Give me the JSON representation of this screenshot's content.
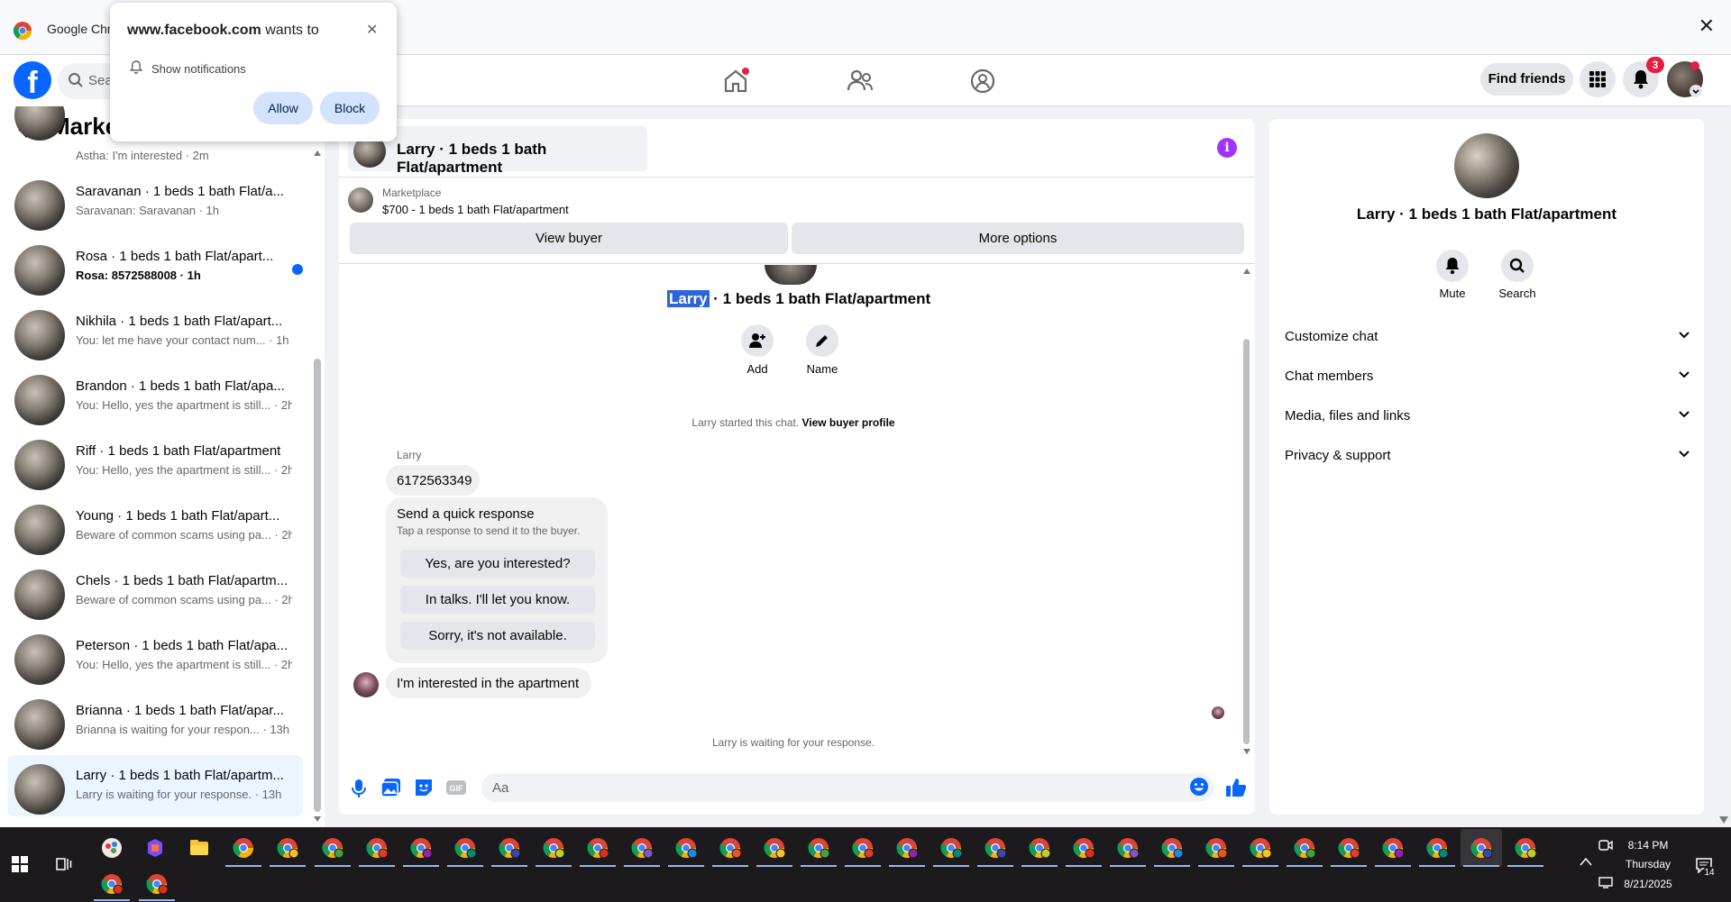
{
  "chrome": {
    "title": "Google Chro",
    "close": "✕"
  },
  "popup": {
    "site": "www.facebook.com",
    "wants": " wants to",
    "perm": "Show notifications",
    "allow": "Allow",
    "block": "Block",
    "close": "✕"
  },
  "fb": {
    "logo": "f",
    "search_placeholder": "Sea",
    "find_friends": "Find friends",
    "notif_count": "3"
  },
  "sidebar": {
    "title": "Marke",
    "conversations": [
      {
        "name": "",
        "preview": "Astha: I'm interested · 2m",
        "unread": false
      },
      {
        "name": "Saravanan · 1 beds 1 bath Flat/a...",
        "preview": "Saravanan: Saravanan · 1h",
        "unread": false
      },
      {
        "name": "Rosa · 1 beds 1 bath Flat/apart...",
        "preview": "Rosa: 8572588008 · 1h",
        "unread": true
      },
      {
        "name": "Nikhila · 1 beds 1 bath Flat/apart...",
        "preview": "You: let me have your contact num... · 1h",
        "unread": false
      },
      {
        "name": "Brandon · 1 beds 1 bath Flat/apa...",
        "preview": "You: Hello, yes the apartment is still... · 2h",
        "unread": false
      },
      {
        "name": "Riff · 1 beds 1 bath Flat/apartment",
        "preview": "You: Hello, yes the apartment is still... · 2h",
        "unread": false
      },
      {
        "name": "Young · 1 beds 1 bath Flat/apart...",
        "preview": "Beware of common scams using pa... · 2h",
        "unread": false
      },
      {
        "name": "Chels · 1 beds 1 bath Flat/apartm...",
        "preview": "Beware of common scams using pa... · 2h",
        "unread": false
      },
      {
        "name": "Peterson · 1 beds 1 bath Flat/apa...",
        "preview": "You: Hello, yes the apartment is still... · 2h",
        "unread": false
      },
      {
        "name": "Brianna · 1 beds 1 bath Flat/apar...",
        "preview": "Brianna is waiting for your respon... · 13h",
        "unread": false
      },
      {
        "name": "Larry · 1 beds 1 bath Flat/apartm...",
        "preview": "Larry is waiting for your response. · 13h",
        "unread": false
      }
    ]
  },
  "chat": {
    "header_title": "Larry · 1 beds 1 bath Flat/apartment",
    "info": "i",
    "marketplace_label": "Marketplace",
    "listing": "$700 - 1 beds 1 bath Flat/apartment",
    "view_buyer": "View buyer",
    "more_options": "More options",
    "name_selected": "Larry",
    "name_rest": " · 1 beds 1 bath Flat/apartment",
    "add_label": "Add",
    "name_label": "Name",
    "started_text": "Larry started this chat. ",
    "view_buyer_profile": "View buyer profile",
    "sender": "Larry",
    "phone_msg": "6172563349",
    "quick_title": "Send a quick response",
    "quick_sub": "Tap a response to send it to the buyer.",
    "quick_replies": [
      "Yes, are you interested?",
      "In talks. I'll let you know.",
      "Sorry, it's not available."
    ],
    "interested_msg": "I'm interested in the apartment",
    "waiting": "Larry is waiting for your response.",
    "composer_placeholder": "Aa"
  },
  "details": {
    "name": "Larry · 1 beds 1 bath Flat/apartment",
    "mute": "Mute",
    "search": "Search",
    "sections": [
      "Customize chat",
      "Chat members",
      "Media, files and links",
      "Privacy & support"
    ]
  },
  "taskbar": {
    "time": "8:14 PM",
    "day": "Thursday",
    "date": "8/21/2025",
    "notif": "14"
  },
  "colors": {
    "fb_blue": "#0866ff",
    "selection": "#2f64d8",
    "badge_red": "#e41e3f",
    "info_purple": "#a033ff"
  }
}
